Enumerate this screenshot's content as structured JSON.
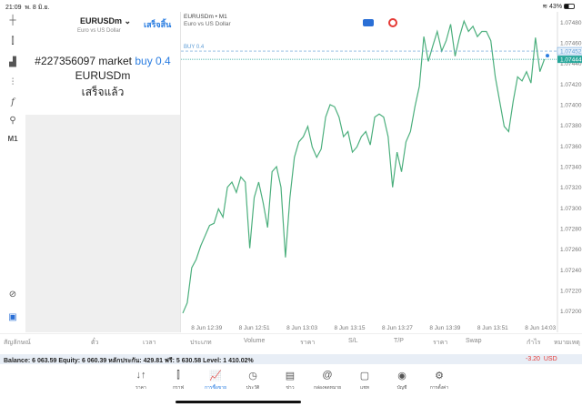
{
  "status": {
    "time": "21:09",
    "date": "พ. 8 มิ.ย.",
    "battery": "43%"
  },
  "toolbar": {
    "timeframe": "M1"
  },
  "order": {
    "symbol": "EURUSDm",
    "description": "Euro vs US Dollar",
    "done_button": "เสร็จสิ้น",
    "message_prefix": "#227356097 market",
    "message_action": "buy 0.4",
    "message_symbol": "EURUSDm",
    "message_status": "เสร็จแล้ว"
  },
  "chart": {
    "title": "EURUSDm • M1",
    "subtitle": "Euro vs US Dollar",
    "order_line_label": "BUY 0.4",
    "ask_label": "1.07452",
    "bid_label": "1.07444",
    "line_color": "#4caf7d",
    "bid_color": "#26a69a",
    "ask_color": "#5b9bd5"
  },
  "chart_data": {
    "type": "line",
    "ylim": [
      1.0719,
      1.0749
    ],
    "y_ticks": [
      "1.07200",
      "1.07220",
      "1.07240",
      "1.07260",
      "1.07280",
      "1.07300",
      "1.07320",
      "1.07340",
      "1.07360",
      "1.07380",
      "1.07400",
      "1.07420",
      "1.07440",
      "1.07460",
      "1.07480"
    ],
    "x_ticks": [
      "8 Jun 12:39",
      "8 Jun 12:51",
      "8 Jun 13:03",
      "8 Jun 13:15",
      "8 Jun 13:27",
      "8 Jun 13:39",
      "8 Jun 13:51",
      "8 Jun 14:03"
    ],
    "x_range": [
      "12:33",
      "14:05"
    ],
    "series": [
      {
        "values": [
          1.07198,
          1.07208,
          1.07242,
          1.0725,
          1.07263,
          1.07273,
          1.07283,
          1.07285,
          1.07299,
          1.07291,
          1.0732,
          1.07325,
          1.07315,
          1.0733,
          1.07325,
          1.07261,
          1.0731,
          1.07325,
          1.07305,
          1.07281,
          1.07335,
          1.0734,
          1.0732,
          1.07252,
          1.0731,
          1.07349,
          1.07364,
          1.07369,
          1.07379,
          1.07359,
          1.07349,
          1.07357,
          1.07388,
          1.074,
          1.07398,
          1.07388,
          1.07369,
          1.07374,
          1.07354,
          1.07359,
          1.07369,
          1.07374,
          1.07361,
          1.07388,
          1.07391,
          1.07388,
          1.07369,
          1.0732,
          1.07354,
          1.07335,
          1.07364,
          1.07374,
          1.07398,
          1.07418,
          1.07466,
          1.07442,
          1.07457,
          1.07471,
          1.07452,
          1.07462,
          1.07478,
          1.07447,
          1.07466,
          1.07481,
          1.07471,
          1.07476,
          1.07466,
          1.07471,
          1.07471,
          1.07462,
          1.07427,
          1.07403,
          1.07379,
          1.07374,
          1.07403,
          1.07427,
          1.07423,
          1.07432,
          1.07421,
          1.07465,
          1.07432,
          1.07444
        ]
      }
    ],
    "order_price": 1.07452,
    "bid": 1.07444
  },
  "table": {
    "headers": [
      "สัญลักษณ์",
      "ตั๋ว",
      "เวลา",
      "ประเภท",
      "Volume",
      "ราคา",
      "S/L",
      "T/P",
      "ราคา",
      "Swap",
      "กำไร",
      "หมายเหตุ"
    ]
  },
  "balance": {
    "text": "Balance: 6 063.59 Equity: 6 060.39 หลักประกัน: 429.81 ฟรี: 5 630.58 Level: 1 410.02%",
    "profit": "-3.20",
    "currency": "USD",
    "profit_color": "#e53935"
  },
  "nav": [
    {
      "label": "ราคา",
      "icon": "↓↑"
    },
    {
      "label": "กราฟ",
      "icon": "⫿"
    },
    {
      "label": "การซื้อขาย",
      "icon": "📈"
    },
    {
      "label": "ประวัติ",
      "icon": "◷"
    },
    {
      "label": "ข่าว",
      "icon": "▤"
    },
    {
      "label": "กล่องจดหมาย",
      "icon": "@"
    },
    {
      "label": "แชท",
      "icon": "▢"
    },
    {
      "label": "บัญชี",
      "icon": "◉"
    },
    {
      "label": "การตั้งค่า",
      "icon": "⚙"
    }
  ]
}
